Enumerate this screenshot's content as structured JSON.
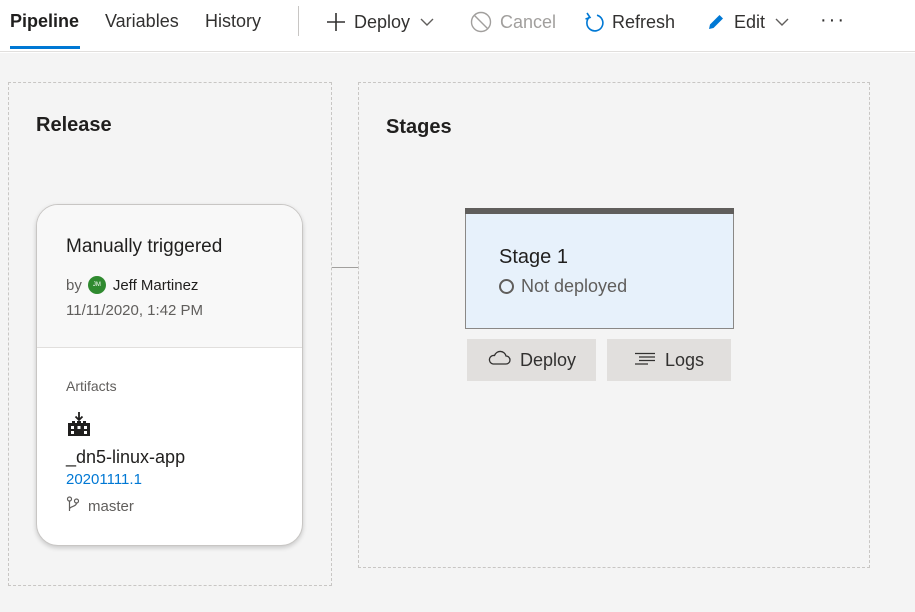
{
  "tabs": [
    {
      "label": "Pipeline",
      "active": true
    },
    {
      "label": "Variables",
      "active": false
    },
    {
      "label": "History",
      "active": false
    }
  ],
  "toolbar": {
    "deploy_label": "Deploy",
    "cancel_label": "Cancel",
    "refresh_label": "Refresh",
    "edit_label": "Edit",
    "more_label": "···"
  },
  "release_panel": {
    "title": "Release",
    "trigger": "Manually triggered",
    "by_label": "by",
    "avatar_initials": "JM",
    "user": "Jeff Martinez",
    "date": "11/11/2020, 1:42 PM",
    "artifacts_label": "Artifacts",
    "artifact_name": "_dn5-linux-app",
    "artifact_version": "20201111.1",
    "artifact_branch": "master"
  },
  "stages_panel": {
    "title": "Stages",
    "stage_name": "Stage 1",
    "stage_status": "Not deployed",
    "deploy_button": "Deploy",
    "logs_button": "Logs"
  },
  "colors": {
    "accent": "#0078d4",
    "stage_background": "#e7f1fb",
    "avatar": "#2f8a2f",
    "canvas": "#f4f4f4"
  },
  "icons": [
    "plus-icon",
    "chevron-down-icon",
    "cancel-icon",
    "refresh-icon",
    "edit-pencil-icon",
    "more-icon",
    "artifact-build-icon",
    "branch-icon",
    "status-circle-icon",
    "cloud-icon",
    "logs-icon"
  ]
}
